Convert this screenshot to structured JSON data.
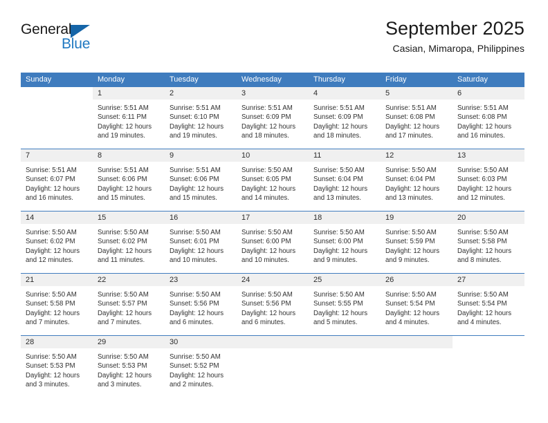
{
  "brand": {
    "name_top": "General",
    "name_bottom": "Blue",
    "accent_color": "#1f78c1",
    "triangle_color": "#1565a8"
  },
  "header": {
    "title": "September 2025",
    "subtitle": "Casian, Mimaropa, Philippines"
  },
  "theme": {
    "header_blue": "#3f7cbe",
    "day_band_gray": "#f0f0f0",
    "text_color": "#303030"
  },
  "weekdays": [
    "Sunday",
    "Monday",
    "Tuesday",
    "Wednesday",
    "Thursday",
    "Friday",
    "Saturday"
  ],
  "weeks": [
    [
      {
        "blank": true
      },
      {
        "day": "1",
        "sunrise": "Sunrise: 5:51 AM",
        "sunset": "Sunset: 6:11 PM",
        "daylight_1": "Daylight: 12 hours",
        "daylight_2": "and 19 minutes."
      },
      {
        "day": "2",
        "sunrise": "Sunrise: 5:51 AM",
        "sunset": "Sunset: 6:10 PM",
        "daylight_1": "Daylight: 12 hours",
        "daylight_2": "and 19 minutes."
      },
      {
        "day": "3",
        "sunrise": "Sunrise: 5:51 AM",
        "sunset": "Sunset: 6:09 PM",
        "daylight_1": "Daylight: 12 hours",
        "daylight_2": "and 18 minutes."
      },
      {
        "day": "4",
        "sunrise": "Sunrise: 5:51 AM",
        "sunset": "Sunset: 6:09 PM",
        "daylight_1": "Daylight: 12 hours",
        "daylight_2": "and 18 minutes."
      },
      {
        "day": "5",
        "sunrise": "Sunrise: 5:51 AM",
        "sunset": "Sunset: 6:08 PM",
        "daylight_1": "Daylight: 12 hours",
        "daylight_2": "and 17 minutes."
      },
      {
        "day": "6",
        "sunrise": "Sunrise: 5:51 AM",
        "sunset": "Sunset: 6:08 PM",
        "daylight_1": "Daylight: 12 hours",
        "daylight_2": "and 16 minutes."
      }
    ],
    [
      {
        "day": "7",
        "sunrise": "Sunrise: 5:51 AM",
        "sunset": "Sunset: 6:07 PM",
        "daylight_1": "Daylight: 12 hours",
        "daylight_2": "and 16 minutes."
      },
      {
        "day": "8",
        "sunrise": "Sunrise: 5:51 AM",
        "sunset": "Sunset: 6:06 PM",
        "daylight_1": "Daylight: 12 hours",
        "daylight_2": "and 15 minutes."
      },
      {
        "day": "9",
        "sunrise": "Sunrise: 5:51 AM",
        "sunset": "Sunset: 6:06 PM",
        "daylight_1": "Daylight: 12 hours",
        "daylight_2": "and 15 minutes."
      },
      {
        "day": "10",
        "sunrise": "Sunrise: 5:50 AM",
        "sunset": "Sunset: 6:05 PM",
        "daylight_1": "Daylight: 12 hours",
        "daylight_2": "and 14 minutes."
      },
      {
        "day": "11",
        "sunrise": "Sunrise: 5:50 AM",
        "sunset": "Sunset: 6:04 PM",
        "daylight_1": "Daylight: 12 hours",
        "daylight_2": "and 13 minutes."
      },
      {
        "day": "12",
        "sunrise": "Sunrise: 5:50 AM",
        "sunset": "Sunset: 6:04 PM",
        "daylight_1": "Daylight: 12 hours",
        "daylight_2": "and 13 minutes."
      },
      {
        "day": "13",
        "sunrise": "Sunrise: 5:50 AM",
        "sunset": "Sunset: 6:03 PM",
        "daylight_1": "Daylight: 12 hours",
        "daylight_2": "and 12 minutes."
      }
    ],
    [
      {
        "day": "14",
        "sunrise": "Sunrise: 5:50 AM",
        "sunset": "Sunset: 6:02 PM",
        "daylight_1": "Daylight: 12 hours",
        "daylight_2": "and 12 minutes."
      },
      {
        "day": "15",
        "sunrise": "Sunrise: 5:50 AM",
        "sunset": "Sunset: 6:02 PM",
        "daylight_1": "Daylight: 12 hours",
        "daylight_2": "and 11 minutes."
      },
      {
        "day": "16",
        "sunrise": "Sunrise: 5:50 AM",
        "sunset": "Sunset: 6:01 PM",
        "daylight_1": "Daylight: 12 hours",
        "daylight_2": "and 10 minutes."
      },
      {
        "day": "17",
        "sunrise": "Sunrise: 5:50 AM",
        "sunset": "Sunset: 6:00 PM",
        "daylight_1": "Daylight: 12 hours",
        "daylight_2": "and 10 minutes."
      },
      {
        "day": "18",
        "sunrise": "Sunrise: 5:50 AM",
        "sunset": "Sunset: 6:00 PM",
        "daylight_1": "Daylight: 12 hours",
        "daylight_2": "and 9 minutes."
      },
      {
        "day": "19",
        "sunrise": "Sunrise: 5:50 AM",
        "sunset": "Sunset: 5:59 PM",
        "daylight_1": "Daylight: 12 hours",
        "daylight_2": "and 9 minutes."
      },
      {
        "day": "20",
        "sunrise": "Sunrise: 5:50 AM",
        "sunset": "Sunset: 5:58 PM",
        "daylight_1": "Daylight: 12 hours",
        "daylight_2": "and 8 minutes."
      }
    ],
    [
      {
        "day": "21",
        "sunrise": "Sunrise: 5:50 AM",
        "sunset": "Sunset: 5:58 PM",
        "daylight_1": "Daylight: 12 hours",
        "daylight_2": "and 7 minutes."
      },
      {
        "day": "22",
        "sunrise": "Sunrise: 5:50 AM",
        "sunset": "Sunset: 5:57 PM",
        "daylight_1": "Daylight: 12 hours",
        "daylight_2": "and 7 minutes."
      },
      {
        "day": "23",
        "sunrise": "Sunrise: 5:50 AM",
        "sunset": "Sunset: 5:56 PM",
        "daylight_1": "Daylight: 12 hours",
        "daylight_2": "and 6 minutes."
      },
      {
        "day": "24",
        "sunrise": "Sunrise: 5:50 AM",
        "sunset": "Sunset: 5:56 PM",
        "daylight_1": "Daylight: 12 hours",
        "daylight_2": "and 6 minutes."
      },
      {
        "day": "25",
        "sunrise": "Sunrise: 5:50 AM",
        "sunset": "Sunset: 5:55 PM",
        "daylight_1": "Daylight: 12 hours",
        "daylight_2": "and 5 minutes."
      },
      {
        "day": "26",
        "sunrise": "Sunrise: 5:50 AM",
        "sunset": "Sunset: 5:54 PM",
        "daylight_1": "Daylight: 12 hours",
        "daylight_2": "and 4 minutes."
      },
      {
        "day": "27",
        "sunrise": "Sunrise: 5:50 AM",
        "sunset": "Sunset: 5:54 PM",
        "daylight_1": "Daylight: 12 hours",
        "daylight_2": "and 4 minutes."
      }
    ],
    [
      {
        "day": "28",
        "sunrise": "Sunrise: 5:50 AM",
        "sunset": "Sunset: 5:53 PM",
        "daylight_1": "Daylight: 12 hours",
        "daylight_2": "and 3 minutes."
      },
      {
        "day": "29",
        "sunrise": "Sunrise: 5:50 AM",
        "sunset": "Sunset: 5:53 PM",
        "daylight_1": "Daylight: 12 hours",
        "daylight_2": "and 3 minutes."
      },
      {
        "day": "30",
        "sunrise": "Sunrise: 5:50 AM",
        "sunset": "Sunset: 5:52 PM",
        "daylight_1": "Daylight: 12 hours",
        "daylight_2": "and 2 minutes."
      },
      {
        "empty": true
      },
      {
        "empty": true
      },
      {
        "empty": true
      },
      {
        "blank": true
      }
    ]
  ]
}
